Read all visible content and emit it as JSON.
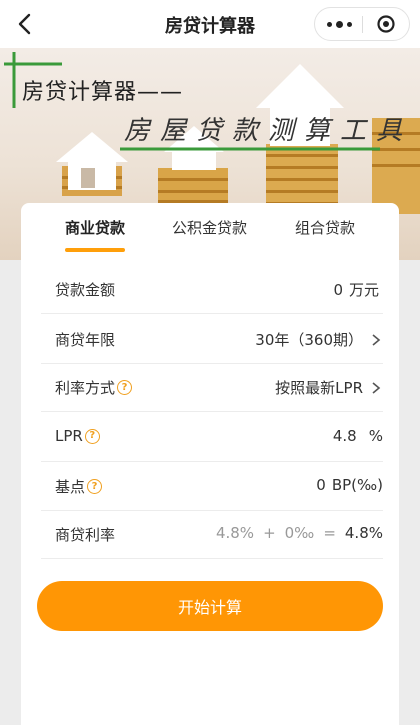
{
  "header": {
    "title": "房贷计算器",
    "icons": [
      "back-arrow-icon",
      "more-dots-icon",
      "close-target-icon"
    ]
  },
  "banner": {
    "title": "房贷计算器——",
    "subtitle": "房屋贷款测算工具",
    "accent_color": "#3a9a3a"
  },
  "tabs": [
    {
      "label": "商业贷款",
      "active": true
    },
    {
      "label": "公积金贷款",
      "active": false
    },
    {
      "label": "组合贷款",
      "active": false
    }
  ],
  "form": {
    "amount": {
      "label": "贷款金额",
      "value": "0",
      "unit": "万元"
    },
    "term": {
      "label": "商贷年限",
      "value": "30年（360期）"
    },
    "rate_mode": {
      "label": "利率方式",
      "value": "按照最新LPR"
    },
    "lpr": {
      "label": "LPR",
      "value": "4.8",
      "unit": "%"
    },
    "bp": {
      "label": "基点",
      "value": "0",
      "unit": "BP(‰)"
    },
    "rate": {
      "label": "商贷利率",
      "lpr_part": "4.8%",
      "plus": "+",
      "bp_part": "0‰",
      "equals": "=",
      "result": "4.8%"
    }
  },
  "button": {
    "label": "开始计算"
  },
  "colors": {
    "accent": "#ff9605",
    "help_icon": "#f0a020"
  }
}
